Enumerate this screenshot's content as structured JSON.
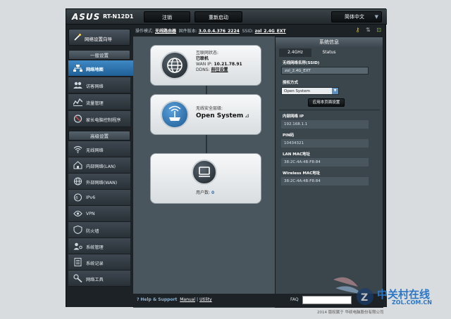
{
  "header": {
    "brand": "ASUS",
    "model": "RT-N12D1",
    "logout_label": "注销",
    "reboot_label": "重新启动",
    "language": "简体中文"
  },
  "info_strip": {
    "mode_label": "操作模式:",
    "mode_value": "无线路由器",
    "firmware_label": "固件版本:",
    "firmware_value": "3.0.0.4.376_2224",
    "ssid_label": "SSID:",
    "ssid_value": "zol_2.4G_EXT"
  },
  "sidebar": {
    "quick_setup": "网络设置向导",
    "general_heading": "一般设置",
    "general_items": [
      {
        "label": "网络地图",
        "icon": "network-map-icon"
      },
      {
        "label": "访客网络",
        "icon": "guest-network-icon"
      },
      {
        "label": "流量管理",
        "icon": "traffic-manager-icon"
      },
      {
        "label": "家长电脑控制程序",
        "icon": "parental-control-icon"
      }
    ],
    "advanced_heading": "高级设置",
    "advanced_items": [
      {
        "label": "无线网络",
        "icon": "wireless-icon"
      },
      {
        "label": "内部网络(LAN)",
        "icon": "lan-icon"
      },
      {
        "label": "外部网络(WAN)",
        "icon": "wan-icon"
      },
      {
        "label": "IPv6",
        "icon": "ipv6-icon"
      },
      {
        "label": "VPN",
        "icon": "vpn-icon"
      },
      {
        "label": "防火墙",
        "icon": "firewall-icon"
      },
      {
        "label": "系统管理",
        "icon": "administration-icon"
      },
      {
        "label": "系统记录",
        "icon": "system-log-icon"
      },
      {
        "label": "网络工具",
        "icon": "network-tools-icon"
      }
    ]
  },
  "map": {
    "internet": {
      "status_label": "互联网状态:",
      "status_value": "已联机",
      "wan_ip_label": "WAN IP:",
      "wan_ip_value": "10.21.78.91",
      "ddns_label": "DDNS:",
      "ddns_value": "前往设置"
    },
    "router": {
      "security_label": "无线安全层级:",
      "security_value": "Open System"
    },
    "clients": {
      "label": "用户数:",
      "count": "0"
    }
  },
  "system_status": {
    "title": "系统信息",
    "tabs": [
      "2.4GHz",
      "Status"
    ],
    "ssid_label": "无线网络名称(SSID)",
    "ssid_value": "zol_2.4G_EXT",
    "auth_label": "授权方式",
    "auth_value": "Open System",
    "apply_label": "应用本页面设置",
    "lan_ip_label": "内部网络 IP",
    "lan_ip_value": "192.168.1.1",
    "pin_label": "PIN码",
    "pin_value": "10434321",
    "lan_mac_label": "LAN MAC地址",
    "lan_mac_value": "38:2C:4A:4B:F8:84",
    "wl_mac_label": "Wireless MAC地址",
    "wl_mac_value": "38:2C:4A:4B:F8:84"
  },
  "footer": {
    "help": "Help & Support",
    "manual": "Manual",
    "sep": "|",
    "utility": "Utility",
    "faq": "FAQ",
    "copyright": "2014 版权属于 华硕电脑股份有限公司"
  },
  "watermark": {
    "cn": "中关村在线",
    "en": "ZOL.COM.CN"
  }
}
